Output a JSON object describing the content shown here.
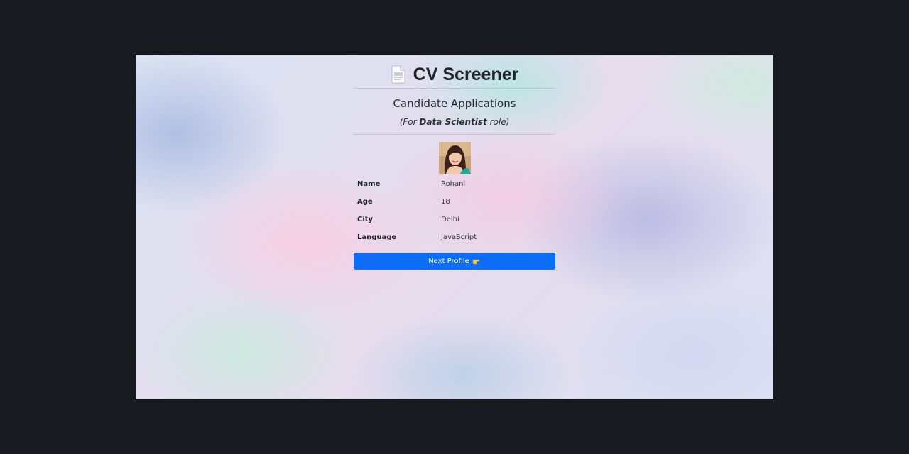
{
  "app": {
    "title": "CV Screener",
    "title_icon": "document-icon"
  },
  "applications": {
    "heading": "Candidate Applications",
    "role_prefix": "(For ",
    "role_name": "Data Scientist",
    "role_suffix": " role)"
  },
  "profile": {
    "avatar": "candidate-photo",
    "fields": [
      {
        "label": "Name",
        "value": "Rohani"
      },
      {
        "label": "Age",
        "value": "18"
      },
      {
        "label": "City",
        "value": "Delhi"
      },
      {
        "label": "Language",
        "value": "JavaScript"
      }
    ]
  },
  "actions": {
    "next_label": "Next Profile",
    "next_icon": "pointing-hand-icon"
  },
  "colors": {
    "page_frame": "#171a1f",
    "button": "#0d6efd",
    "text": "#212529"
  }
}
